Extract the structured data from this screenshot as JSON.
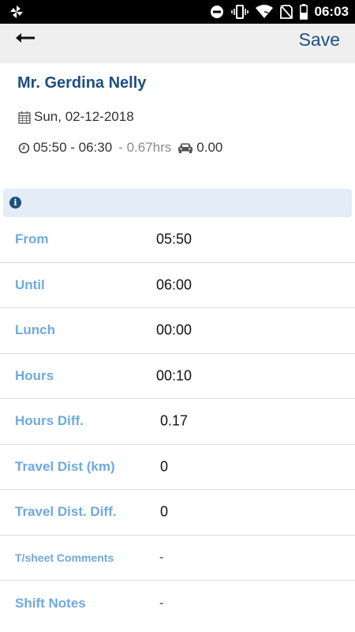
{
  "status_bar": {
    "time": "06:03",
    "icons": [
      "pinwheel-icon",
      "do-not-disturb-icon",
      "vibrate-icon",
      "wifi-icon",
      "no-sim-icon",
      "battery-icon"
    ]
  },
  "app_bar": {
    "back_icon": "arrow-left-icon",
    "save_label": "Save"
  },
  "header": {
    "name": "Mr. Gerdina Nelly",
    "date": "Sun, 02-12-2018",
    "time_range": "05:50 - 06:30",
    "duration": "- 0.67hrs",
    "distance": "0.00"
  },
  "info_banner": {
    "icon": "info-icon"
  },
  "fields": [
    {
      "label": "From",
      "value": "05:50"
    },
    {
      "label": "Until",
      "value": "06:00"
    },
    {
      "label": "Lunch",
      "value": "00:00"
    },
    {
      "label": "Hours",
      "value": "00:10"
    },
    {
      "label": "Hours Diff.",
      "value": "0.17"
    },
    {
      "label": "Travel Dist (km)",
      "value": "0"
    },
    {
      "label": "Travel Dist. Diff.",
      "value": "0"
    },
    {
      "label": "T/sheet Comments",
      "value": "-"
    },
    {
      "label": "Shift Notes",
      "value": "-"
    }
  ],
  "colors": {
    "title_blue": "#1d4f80",
    "label_blue": "#6fa9de",
    "appbar_bg": "#efefef",
    "banner_bg": "#e4ecf7"
  }
}
